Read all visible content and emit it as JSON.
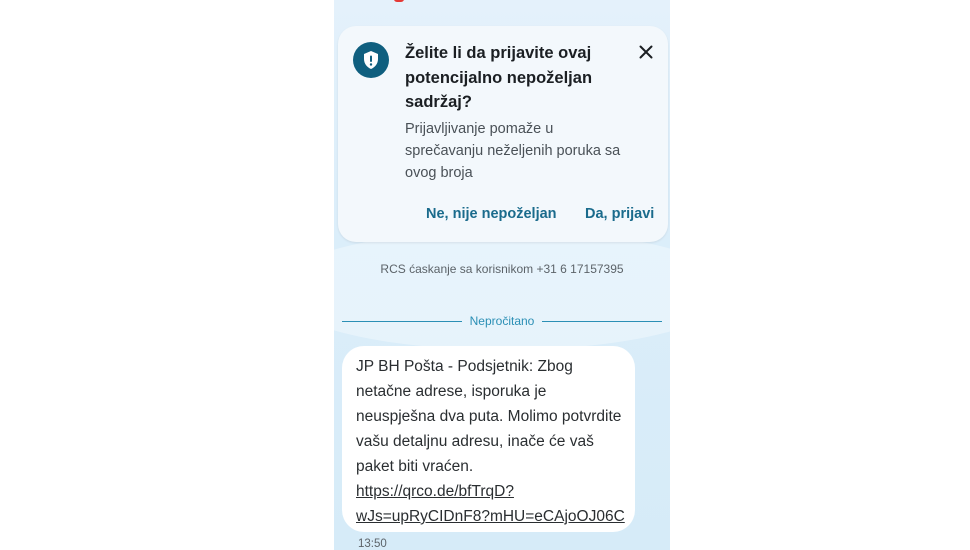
{
  "spam_prompt": {
    "title": "Želite li da prijavite ovaj potencijalno nepoželjan sadržaj?",
    "description": "Prijavljivanje pomaže u sprečavanju neželjenih poruka sa ovog broja",
    "dismiss_label": "Ne, nije nepoželjan",
    "report_label": "Da, prijavi",
    "icon": "shield-exclamation-icon",
    "close_icon": "close-icon"
  },
  "conversation": {
    "rcs_info": "RCS ćaskanje sa korisnikom +31 6 17157395",
    "unread_label": "Nepročitano"
  },
  "message": {
    "text": "JP BH Pošta - Podsjetnik: Zbog netačne adrese, isporuka je neuspješna dva puta. Molimo potvrdite vašu detaljnu adresu, inače će vaš paket biti vraćen.",
    "link": "https://qrco.de/bfTrqD?wJs=upRyCIDnF8?mHU=eCAjoOJ06C",
    "time": "13:50"
  },
  "colors": {
    "accent": "#1a6b8c",
    "shield_bg": "#0f5f7f",
    "divider": "#2b8fb5",
    "background": "#dceefa"
  }
}
